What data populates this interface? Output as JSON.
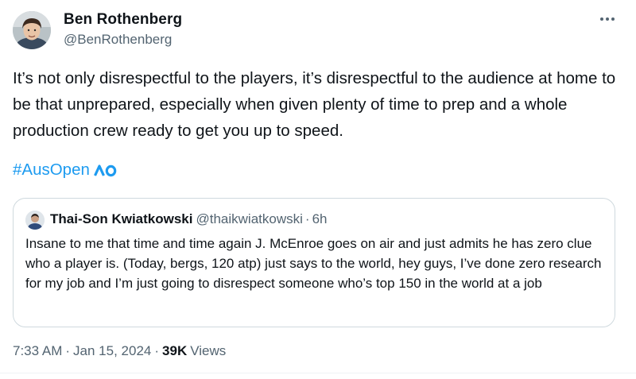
{
  "author": {
    "name": "Ben Rothenberg",
    "handle": "@BenRothenberg"
  },
  "tweet": {
    "text": "It’s not only disrespectful to the players, it’s disrespectful to the audience at home to be that unprepared, especially when given plenty of time to prep and a whole production crew ready to get you up to speed.",
    "hashtag": "#AusOpen",
    "hashtag_logo_icon": "ao-logo-icon"
  },
  "quote": {
    "name": "Thai-Son Kwiatkowski",
    "handle": "@thaikwiatkowski",
    "dot": "·",
    "time": "6h",
    "text": "Insane to me that time and time again J. McEnroe goes on air and just admits he has zero clue who a player is. (Today, bergs, 120 atp) just says to the world, hey guys, I’ve done zero research for my job and I’m just going to disrespect someone who’s top 150 in the world at a job"
  },
  "meta": {
    "time": "7:33 AM",
    "sep1": "·",
    "date": "Jan 15, 2024",
    "sep2": "·",
    "views_count": "39K",
    "views_label": "Views"
  },
  "icons": {
    "more": "more-horizontal-icon"
  },
  "colors": {
    "link": "#1d9bf0",
    "secondary_text": "#536471",
    "primary_text": "#0f1419",
    "border": "#cfd9de"
  }
}
